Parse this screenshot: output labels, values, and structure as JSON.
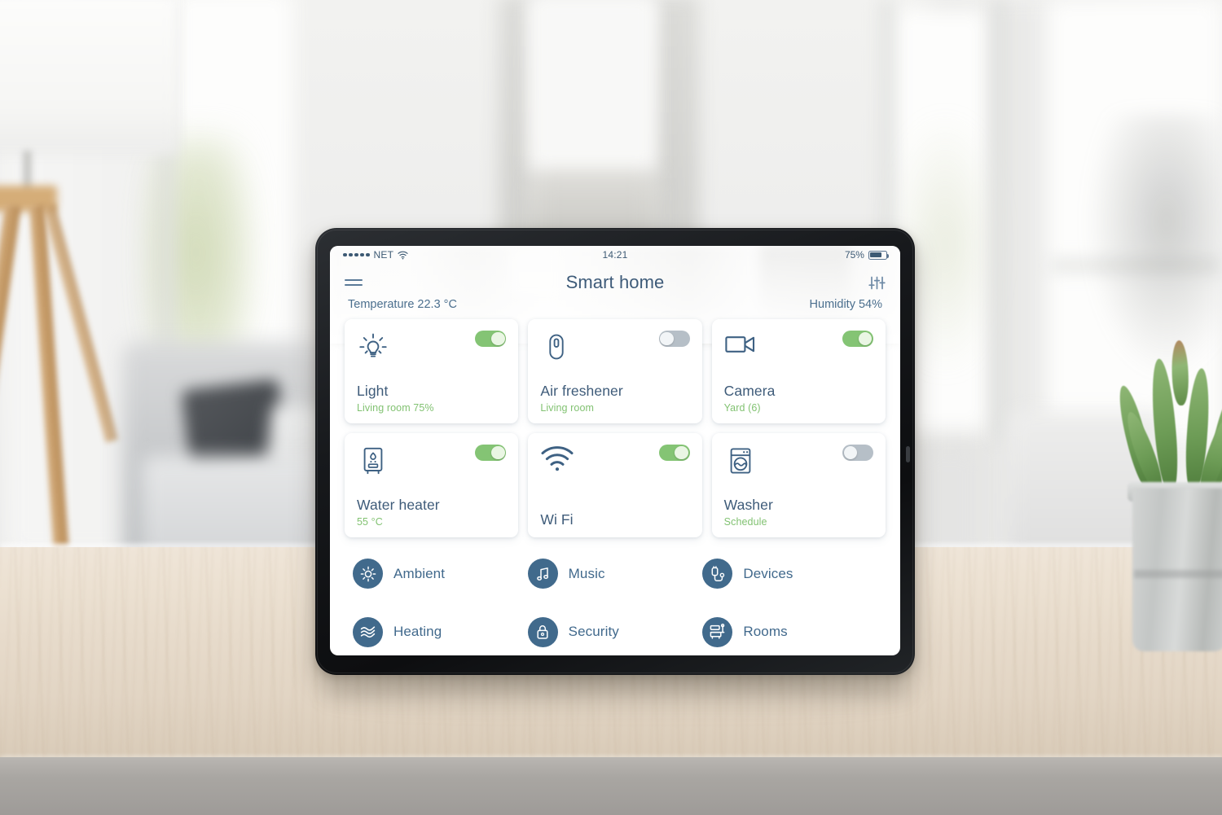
{
  "status_bar": {
    "carrier": "NET",
    "signal_dots": 5,
    "wifi_icon": "wifi-icon",
    "time": "14:21",
    "battery_percent": "75%",
    "battery_level": 75,
    "battery_icon": "battery-icon"
  },
  "header": {
    "menu_icon": "hamburger-menu-icon",
    "title": "Smart home",
    "settings_icon": "sliders-icon"
  },
  "readouts": {
    "temperature": "Temperature 22.3 °C",
    "humidity": "Humidity 54%"
  },
  "colors": {
    "accent_blue": "#3e5b79",
    "icon_blue": "#3e6183",
    "menu_circle": "#416a8c",
    "toggle_on": "#84c474",
    "toggle_off": "#b6bfc7",
    "subtitle_green": "#82c272",
    "card_bg": "#ffffff"
  },
  "cards": [
    {
      "icon": "lightbulb-icon",
      "title": "Light",
      "subtitle": "Living room 75%",
      "toggle": "on"
    },
    {
      "icon": "air-freshener-icon",
      "title": "Air freshener",
      "subtitle": "Living room",
      "toggle": "off"
    },
    {
      "icon": "video-camera-icon",
      "title": "Camera",
      "subtitle": "Yard (6)",
      "toggle": "on"
    },
    {
      "icon": "water-heater-icon",
      "title": "Water heater",
      "subtitle": "55 °C",
      "toggle": "on"
    },
    {
      "icon": "wifi-icon",
      "title": "Wi Fi",
      "subtitle": "",
      "toggle": "on"
    },
    {
      "icon": "washing-machine-icon",
      "title": "Washer",
      "subtitle": "Schedule",
      "toggle": "off"
    }
  ],
  "menu_items": [
    {
      "icon": "sun-icon",
      "label": "Ambient"
    },
    {
      "icon": "music-note-icon",
      "label": "Music"
    },
    {
      "icon": "plug-icon",
      "label": "Devices"
    },
    {
      "icon": "waves-icon",
      "label": "Heating"
    },
    {
      "icon": "lock-icon",
      "label": "Security"
    },
    {
      "icon": "sofa-icon",
      "label": "Rooms"
    }
  ]
}
